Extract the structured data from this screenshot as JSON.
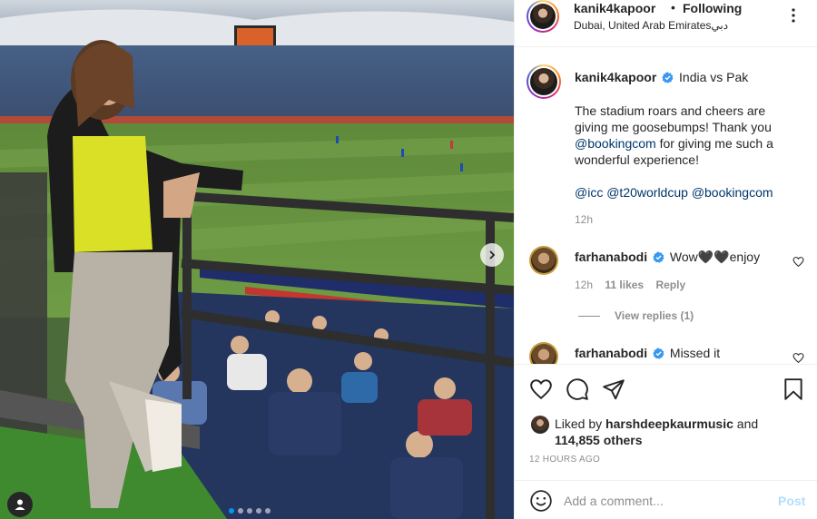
{
  "header": {
    "username": "kanik4kapoor",
    "separator": "•",
    "follow_status": "Following",
    "location": "Dubai, United Arab Emiratesدبي"
  },
  "caption": {
    "username": "kanik4kapoor",
    "title": "India vs Pak",
    "text_before": "The stadium roars and cheers are giving me goosebumps! Thank you ",
    "mention_1": "@bookingcom",
    "text_after": " for giving me such a wonderful experience!",
    "tags": [
      "@icc",
      "@t20worldcup",
      "@bookingcom"
    ],
    "time": "12h"
  },
  "comments": [
    {
      "username": "farhanabodi",
      "text": "Wow🖤🖤enjoy",
      "time": "12h",
      "likes": "11 likes",
      "reply_label": "Reply",
      "view_replies": "View replies (1)"
    },
    {
      "username": "farhanabodi",
      "text": "Missed it"
    }
  ],
  "actions": {
    "liked_by_prefix": "Liked by ",
    "liked_by_user": "harshdeepkaurmusic",
    "liked_by_mid": " and",
    "liked_by_count": "114,855 others",
    "time_ago": "12 HOURS AGO"
  },
  "composer": {
    "placeholder": "Add a comment...",
    "post_label": "Post"
  },
  "icons": {
    "more": "more-options-icon",
    "like": "heart-icon",
    "comment": "comment-icon",
    "share": "paper-plane-icon",
    "save": "bookmark-icon",
    "emoji": "emoji-icon",
    "verified": "verified-badge-icon",
    "next": "chevron-right-icon",
    "tag": "user-tag-icon"
  },
  "carousel": {
    "total_slides": 5,
    "active_slide": 1
  },
  "colors": {
    "verified": "#3897f0",
    "link": "#00376b",
    "secondary_text": "#8e8e8e",
    "post_disabled": "#b2dffc",
    "carousel_active": "#0095f6"
  }
}
